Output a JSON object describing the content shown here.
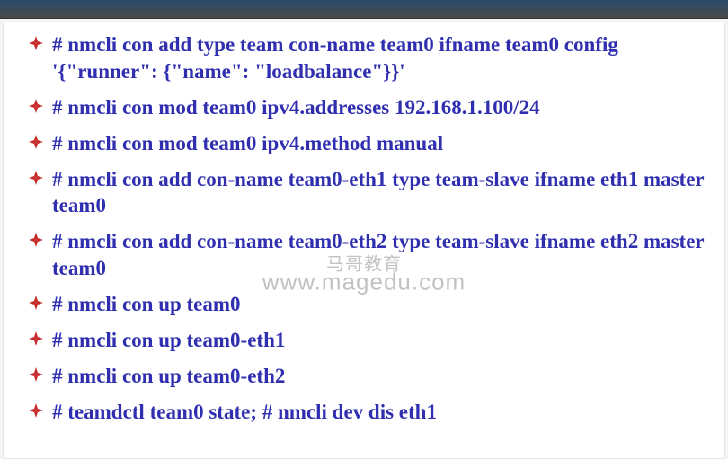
{
  "commands": [
    "# nmcli con add type team con-name team0 ifname team0 config '{\"runner\": {\"name\": \"loadbalance\"}}'",
    "# nmcli con mod team0 ipv4.addresses 192.168.1.100/24",
    "# nmcli con mod team0 ipv4.method manual",
    "# nmcli con add con-name team0-eth1 type team-slave ifname eth1 master team0",
    "# nmcli con add con-name team0-eth2 type team-slave ifname eth2 master team0",
    "# nmcli con up team0",
    "# nmcli con up team0-eth1",
    "# nmcli con up team0-eth2",
    "# teamdctl team0 state; # nmcli dev dis eth1"
  ],
  "watermark": {
    "line1": "马哥教育",
    "line2": "www.magedu.com"
  },
  "bullet_color": "#c62828"
}
